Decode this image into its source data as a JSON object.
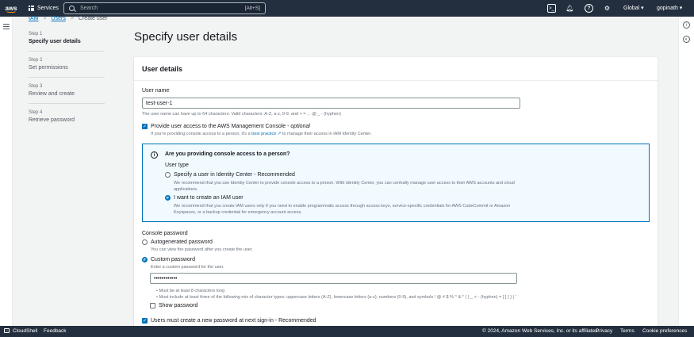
{
  "topnav": {
    "logo_text": "aws",
    "services_label": "Services",
    "search_placeholder": "Search",
    "search_shortcut": "[Alt+S]",
    "region": "Global",
    "user": "gopinath"
  },
  "breadcrumb": {
    "iam": "IAM",
    "users": "Users",
    "current": "Create user",
    "separator": ">"
  },
  "steps": [
    {
      "num": "Step 1",
      "name": "Specify user details",
      "active": true
    },
    {
      "num": "Step 2",
      "name": "Set permissions",
      "active": false
    },
    {
      "num": "Step 3",
      "name": "Review and create",
      "active": false
    },
    {
      "num": "Step 4",
      "name": "Retrieve password",
      "active": false
    }
  ],
  "page_title": "Specify user details",
  "panel": {
    "header": "User details",
    "username_label": "User name",
    "username_value": "test-user-1",
    "username_hint": "The user name can have up to 64 characters. Valid characters: A-Z, a-z, 0-9, and + = , . @ _ - (hyphen)",
    "console_access_label": "Provide user access to the AWS Management Console - ",
    "console_access_optional": "optional",
    "console_access_hint_pre": "If you're providing console access to a person, it's a ",
    "console_access_hint_link": "best practice",
    "console_access_hint_post": " to manage their access in IAM Identity Center.",
    "info_title": "Are you providing console access to a person?",
    "user_type_label": "User type",
    "option_identity_center": "Specify a user in Identity Center - Recommended",
    "option_identity_center_desc": "We recommend that you use Identity Center to provide console access to a person. With Identity Center, you can centrally manage user access to their AWS accounts and cloud applications.",
    "option_iam_user": "I want to create an IAM user",
    "option_iam_user_desc": "We recommend that you create IAM users only if you need to enable programmatic access through access keys, service-specific credentials for AWS CodeCommit or Amazon Keyspaces, or a backup credential for emergency account access.",
    "console_password_label": "Console password",
    "autogen_label": "Autogenerated password",
    "autogen_hint": "You can view the password after you create the user.",
    "custom_label": "Custom password",
    "custom_hint": "Enter a custom password for the user.",
    "password_value": "••••••••••••",
    "rule1": "Must be at least 8 characters long",
    "rule2": "Must include at least three of the following mix of character types: uppercase letters (A-Z), lowercase letters (a-z), numbers (0-9), and symbols ! @ # $ % ^ & * ( ) _ + - (hyphen) = [ ] { } | '",
    "show_password": "Show password",
    "must_create_new": "Users must create a new password at next sign-in - Recommended"
  },
  "bottombar": {
    "cloudshell": "CloudShell",
    "feedback": "Feedback",
    "copyright": "© 2024, Amazon Web Services, Inc. or its affiliates.",
    "privacy": "Privacy",
    "terms": "Terms",
    "cookies": "Cookie preferences"
  }
}
